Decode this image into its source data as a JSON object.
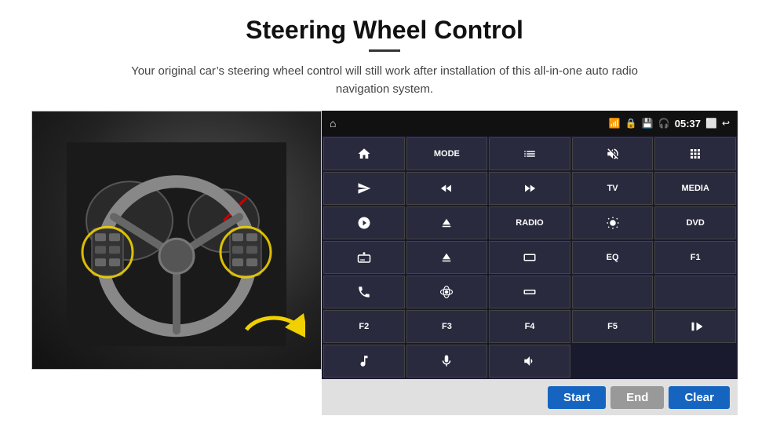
{
  "header": {
    "title": "Steering Wheel Control",
    "subtitle": "Your original car’s steering wheel control will still work after installation of this all-in-one auto radio navigation system."
  },
  "status_bar": {
    "time": "05:37"
  },
  "grid_buttons": [
    {
      "id": "b1",
      "type": "icon",
      "icon": "home"
    },
    {
      "id": "b2",
      "label": "MODE"
    },
    {
      "id": "b3",
      "type": "icon",
      "icon": "list"
    },
    {
      "id": "b4",
      "type": "icon",
      "icon": "mute"
    },
    {
      "id": "b5",
      "type": "icon",
      "icon": "dots-grid"
    },
    {
      "id": "b6",
      "type": "icon",
      "icon": "send"
    },
    {
      "id": "b7",
      "type": "icon",
      "icon": "rewind"
    },
    {
      "id": "b8",
      "type": "icon",
      "icon": "fastforward"
    },
    {
      "id": "b9",
      "label": "TV"
    },
    {
      "id": "b10",
      "label": "MEDIA"
    },
    {
      "id": "b11",
      "type": "icon",
      "icon": "settings-circle"
    },
    {
      "id": "b12",
      "type": "icon",
      "icon": "eject"
    },
    {
      "id": "b13",
      "label": "RADIO"
    },
    {
      "id": "b14",
      "type": "icon",
      "icon": "brightness"
    },
    {
      "id": "b15",
      "label": "DVD"
    },
    {
      "id": "b16",
      "type": "icon",
      "icon": "360cam"
    },
    {
      "id": "b17",
      "type": "icon",
      "icon": "eject2"
    },
    {
      "id": "b18",
      "label": ""
    },
    {
      "id": "b19",
      "label": "EQ"
    },
    {
      "id": "b20",
      "label": "F1"
    },
    {
      "id": "b21",
      "type": "icon",
      "icon": "phone"
    },
    {
      "id": "b22",
      "type": "icon",
      "icon": "orbit"
    },
    {
      "id": "b23",
      "type": "icon",
      "icon": "rectangle"
    },
    {
      "id": "b24",
      "label": ""
    },
    {
      "id": "b25",
      "label": ""
    },
    {
      "id": "b26",
      "label": "F2"
    },
    {
      "id": "b27",
      "label": "F3"
    },
    {
      "id": "b28",
      "label": "F4"
    },
    {
      "id": "b29",
      "label": "F5"
    },
    {
      "id": "b30",
      "type": "icon",
      "icon": "play-pause"
    },
    {
      "id": "b31",
      "type": "icon",
      "icon": "music-note"
    },
    {
      "id": "b32",
      "type": "icon",
      "icon": "mic"
    },
    {
      "id": "b33",
      "type": "icon",
      "icon": "vol-phone"
    }
  ],
  "bottom_bar": {
    "start_label": "Start",
    "end_label": "End",
    "clear_label": "Clear"
  },
  "colors": {
    "accent_blue": "#1565c0",
    "panel_bg": "#1a1a2e",
    "button_bg": "#2a2a3e"
  }
}
